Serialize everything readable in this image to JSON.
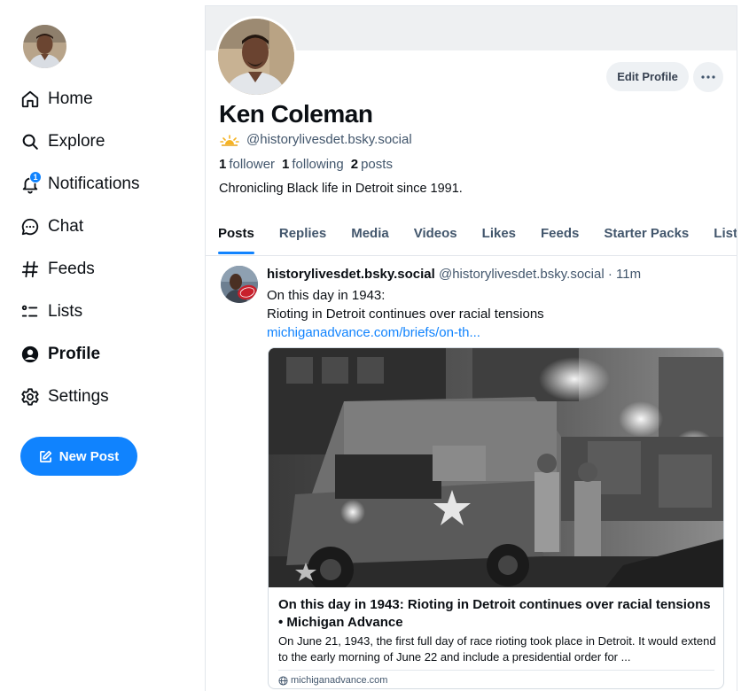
{
  "nav": {
    "items": [
      {
        "label": "Home",
        "icon": "home-icon"
      },
      {
        "label": "Explore",
        "icon": "search-icon"
      },
      {
        "label": "Notifications",
        "icon": "bell-icon",
        "badge": "1"
      },
      {
        "label": "Chat",
        "icon": "chat-icon"
      },
      {
        "label": "Feeds",
        "icon": "hash-icon"
      },
      {
        "label": "Lists",
        "icon": "list-icon"
      },
      {
        "label": "Profile",
        "icon": "user-circle-icon",
        "active": true
      },
      {
        "label": "Settings",
        "icon": "gear-icon"
      }
    ],
    "new_post_label": "New Post"
  },
  "profile": {
    "display_name": "Ken Coleman",
    "handle": "@historylivesdet.bsky.social",
    "followers_count": "1",
    "followers_label": "follower",
    "following_count": "1",
    "following_label": "following",
    "posts_count": "2",
    "posts_label": "posts",
    "bio": "Chronicling Black life in Detroit since 1991.",
    "edit_label": "Edit Profile",
    "more_label": "⋯"
  },
  "tabs": [
    "Posts",
    "Replies",
    "Media",
    "Videos",
    "Likes",
    "Feeds",
    "Starter Packs",
    "List"
  ],
  "post": {
    "author": "historylivesdet.bsky.social",
    "meta": "@historylivesdet.bsky.social · 11m",
    "line1": "On this day in 1943:",
    "line2": "Rioting in Detroit continues over racial tensions",
    "link": "michiganadvance.com/briefs/on-th...",
    "embed": {
      "title": "On this day in 1943: Rioting in Detroit continues over racial tensions • Michigan Advance",
      "description": "On June 21, 1943, the first full day of race rioting took place in Detroit. It would extend to the early morning of June 22 and include a presidential order for ...",
      "domain": "michiganadvance.com"
    }
  },
  "colors": {
    "accent": "#1083fe",
    "muted_text": "#42566c",
    "border": "#e3e7ec"
  }
}
